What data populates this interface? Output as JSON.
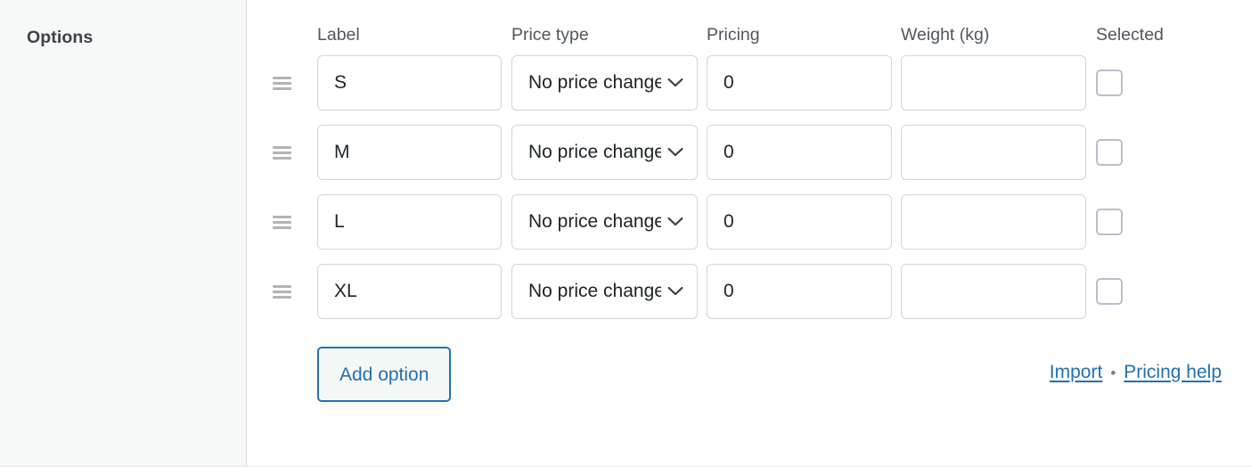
{
  "section": {
    "title": "Options"
  },
  "table": {
    "headers": {
      "label": "Label",
      "price_type": "Price type",
      "pricing": "Pricing",
      "weight": "Weight (kg)",
      "selected": "Selected"
    },
    "rows": [
      {
        "drag_handle": "drag-handle-icon",
        "label": "S",
        "price_type": "No price change",
        "pricing": "0",
        "weight": "",
        "selected": false
      },
      {
        "drag_handle": "drag-handle-icon",
        "label": "M",
        "price_type": "No price change",
        "pricing": "0",
        "weight": "",
        "selected": false
      },
      {
        "drag_handle": "drag-handle-icon",
        "label": "L",
        "price_type": "No price change",
        "pricing": "0",
        "weight": "",
        "selected": false
      },
      {
        "drag_handle": "drag-handle-icon",
        "label": "XL",
        "price_type": "No price change",
        "pricing": "0",
        "weight": "",
        "selected": false
      }
    ]
  },
  "footer": {
    "add_option_label": "Add option",
    "import_label": "Import",
    "separator": "•",
    "pricing_help_label": "Pricing help"
  },
  "colors": {
    "link": "#2271b1",
    "button_border": "#2271b1",
    "field_border": "#cfd6dd",
    "sidebar_bg": "#f7f8f8",
    "text": "#3c434a"
  }
}
